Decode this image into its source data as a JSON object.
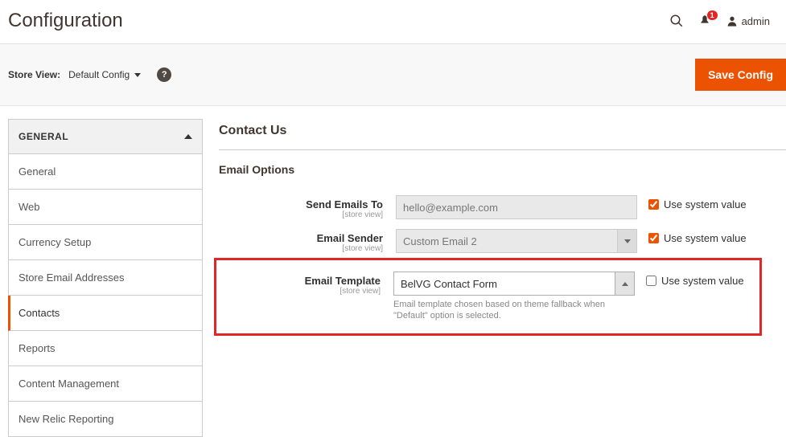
{
  "header": {
    "title": "Configuration",
    "notification_count": "1",
    "username": "admin"
  },
  "toolbar": {
    "store_view_label": "Store View:",
    "store_view_value": "Default Config",
    "save_label": "Save Config"
  },
  "sidebar": {
    "group_label": "GENERAL",
    "items": [
      {
        "label": "General"
      },
      {
        "label": "Web"
      },
      {
        "label": "Currency Setup"
      },
      {
        "label": "Store Email Addresses"
      },
      {
        "label": "Contacts"
      },
      {
        "label": "Reports"
      },
      {
        "label": "Content Management"
      },
      {
        "label": "New Relic Reporting"
      }
    ]
  },
  "main": {
    "section_title": "Contact Us",
    "subsection_title": "Email Options",
    "rows": {
      "send_to": {
        "label": "Send Emails To",
        "scope": "[store view]",
        "value": "hello@example.com",
        "use_system": "Use system value"
      },
      "sender": {
        "label": "Email Sender",
        "scope": "[store view]",
        "value": "Custom Email 2",
        "use_system": "Use system value"
      },
      "template": {
        "label": "Email Template",
        "scope": "[store view]",
        "value": "BelVG Contact Form",
        "hint": "Email template chosen based on theme fallback when \"Default\" option is selected.",
        "use_system": "Use system value"
      }
    }
  }
}
